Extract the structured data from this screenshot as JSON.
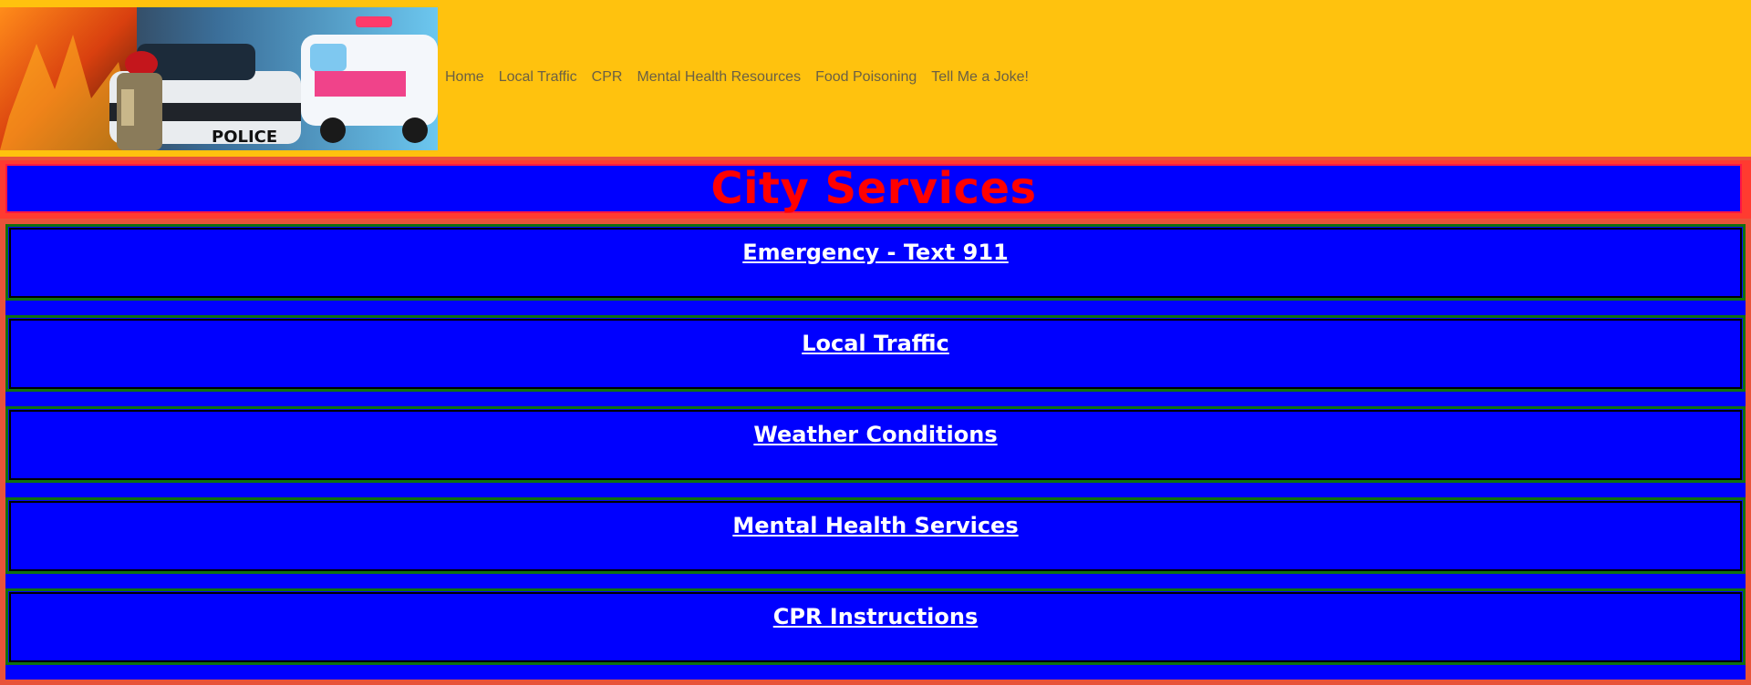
{
  "header": {
    "banner_alt": "Emergency services banner: firefighter, police car, ambulance",
    "nav": [
      "Home",
      "Local Traffic",
      "CPR",
      "Mental Health Resources",
      "Food Poisoning",
      "Tell Me a Joke!"
    ]
  },
  "page_title": "City Services",
  "services": [
    {
      "label": "Emergency - Text 911"
    },
    {
      "label": "Local Traffic"
    },
    {
      "label": "Weather Conditions"
    },
    {
      "label": "Mental Health Services"
    },
    {
      "label": "CPR Instructions"
    }
  ],
  "colors": {
    "header_bg": "#ffc20e",
    "title_text": "#ff0000",
    "panel_bg": "#0000ff",
    "panel_border": "#107010",
    "page_bg": "#e8533a"
  }
}
